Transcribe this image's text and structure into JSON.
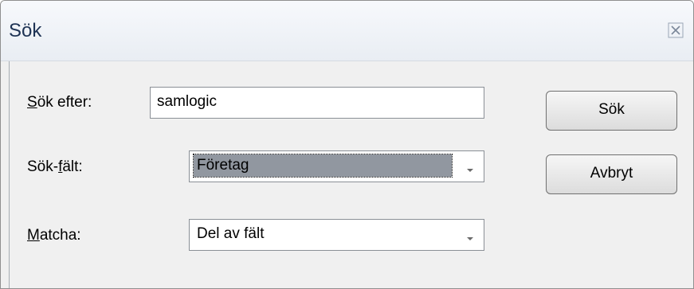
{
  "window": {
    "title": "Sök"
  },
  "fields": {
    "search_for": {
      "label_accesskey": "S",
      "label_rest": "ök efter:",
      "value": "samlogic"
    },
    "search_field": {
      "label_prefix": "Sök-",
      "label_accesskey": "f",
      "label_rest": "ält:",
      "value": "Företag"
    },
    "match": {
      "label_accesskey": "M",
      "label_rest": "atcha:",
      "value": "Del av fält"
    }
  },
  "buttons": {
    "search": "Sök",
    "cancel": "Avbryt"
  },
  "icons": {
    "close": "close-icon",
    "dropdown": "chevron-down-icon"
  }
}
